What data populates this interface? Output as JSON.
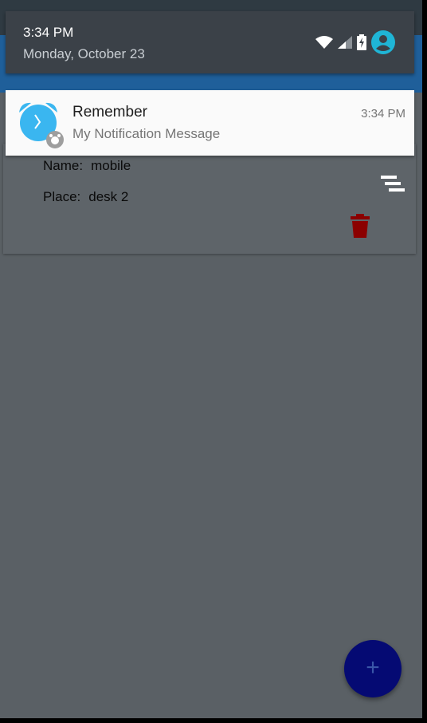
{
  "status_bar": {
    "time": "3:34 PM",
    "date": "Monday, October 23",
    "icons": [
      "wifi-icon",
      "signal-icon",
      "battery-charging-icon",
      "account-icon"
    ]
  },
  "notification": {
    "app_icon": "alarm-clock-icon",
    "title": "Remember",
    "message": "My Notification Message",
    "time": "3:34 PM"
  },
  "card": {
    "name_label": "Name:",
    "name_value": "mobile",
    "place_label": "Place:",
    "place_value": "desk 2",
    "icons": [
      "reorder-icon",
      "delete-icon"
    ]
  },
  "fab": {
    "label": "+",
    "icon": "add-icon"
  },
  "colors": {
    "shade_background": "#3b4148",
    "dimmed_app_background": "#5a6065",
    "alarm_icon": "#3ab6f0",
    "delete_icon": "#8b0000",
    "fab": "#050a73"
  }
}
